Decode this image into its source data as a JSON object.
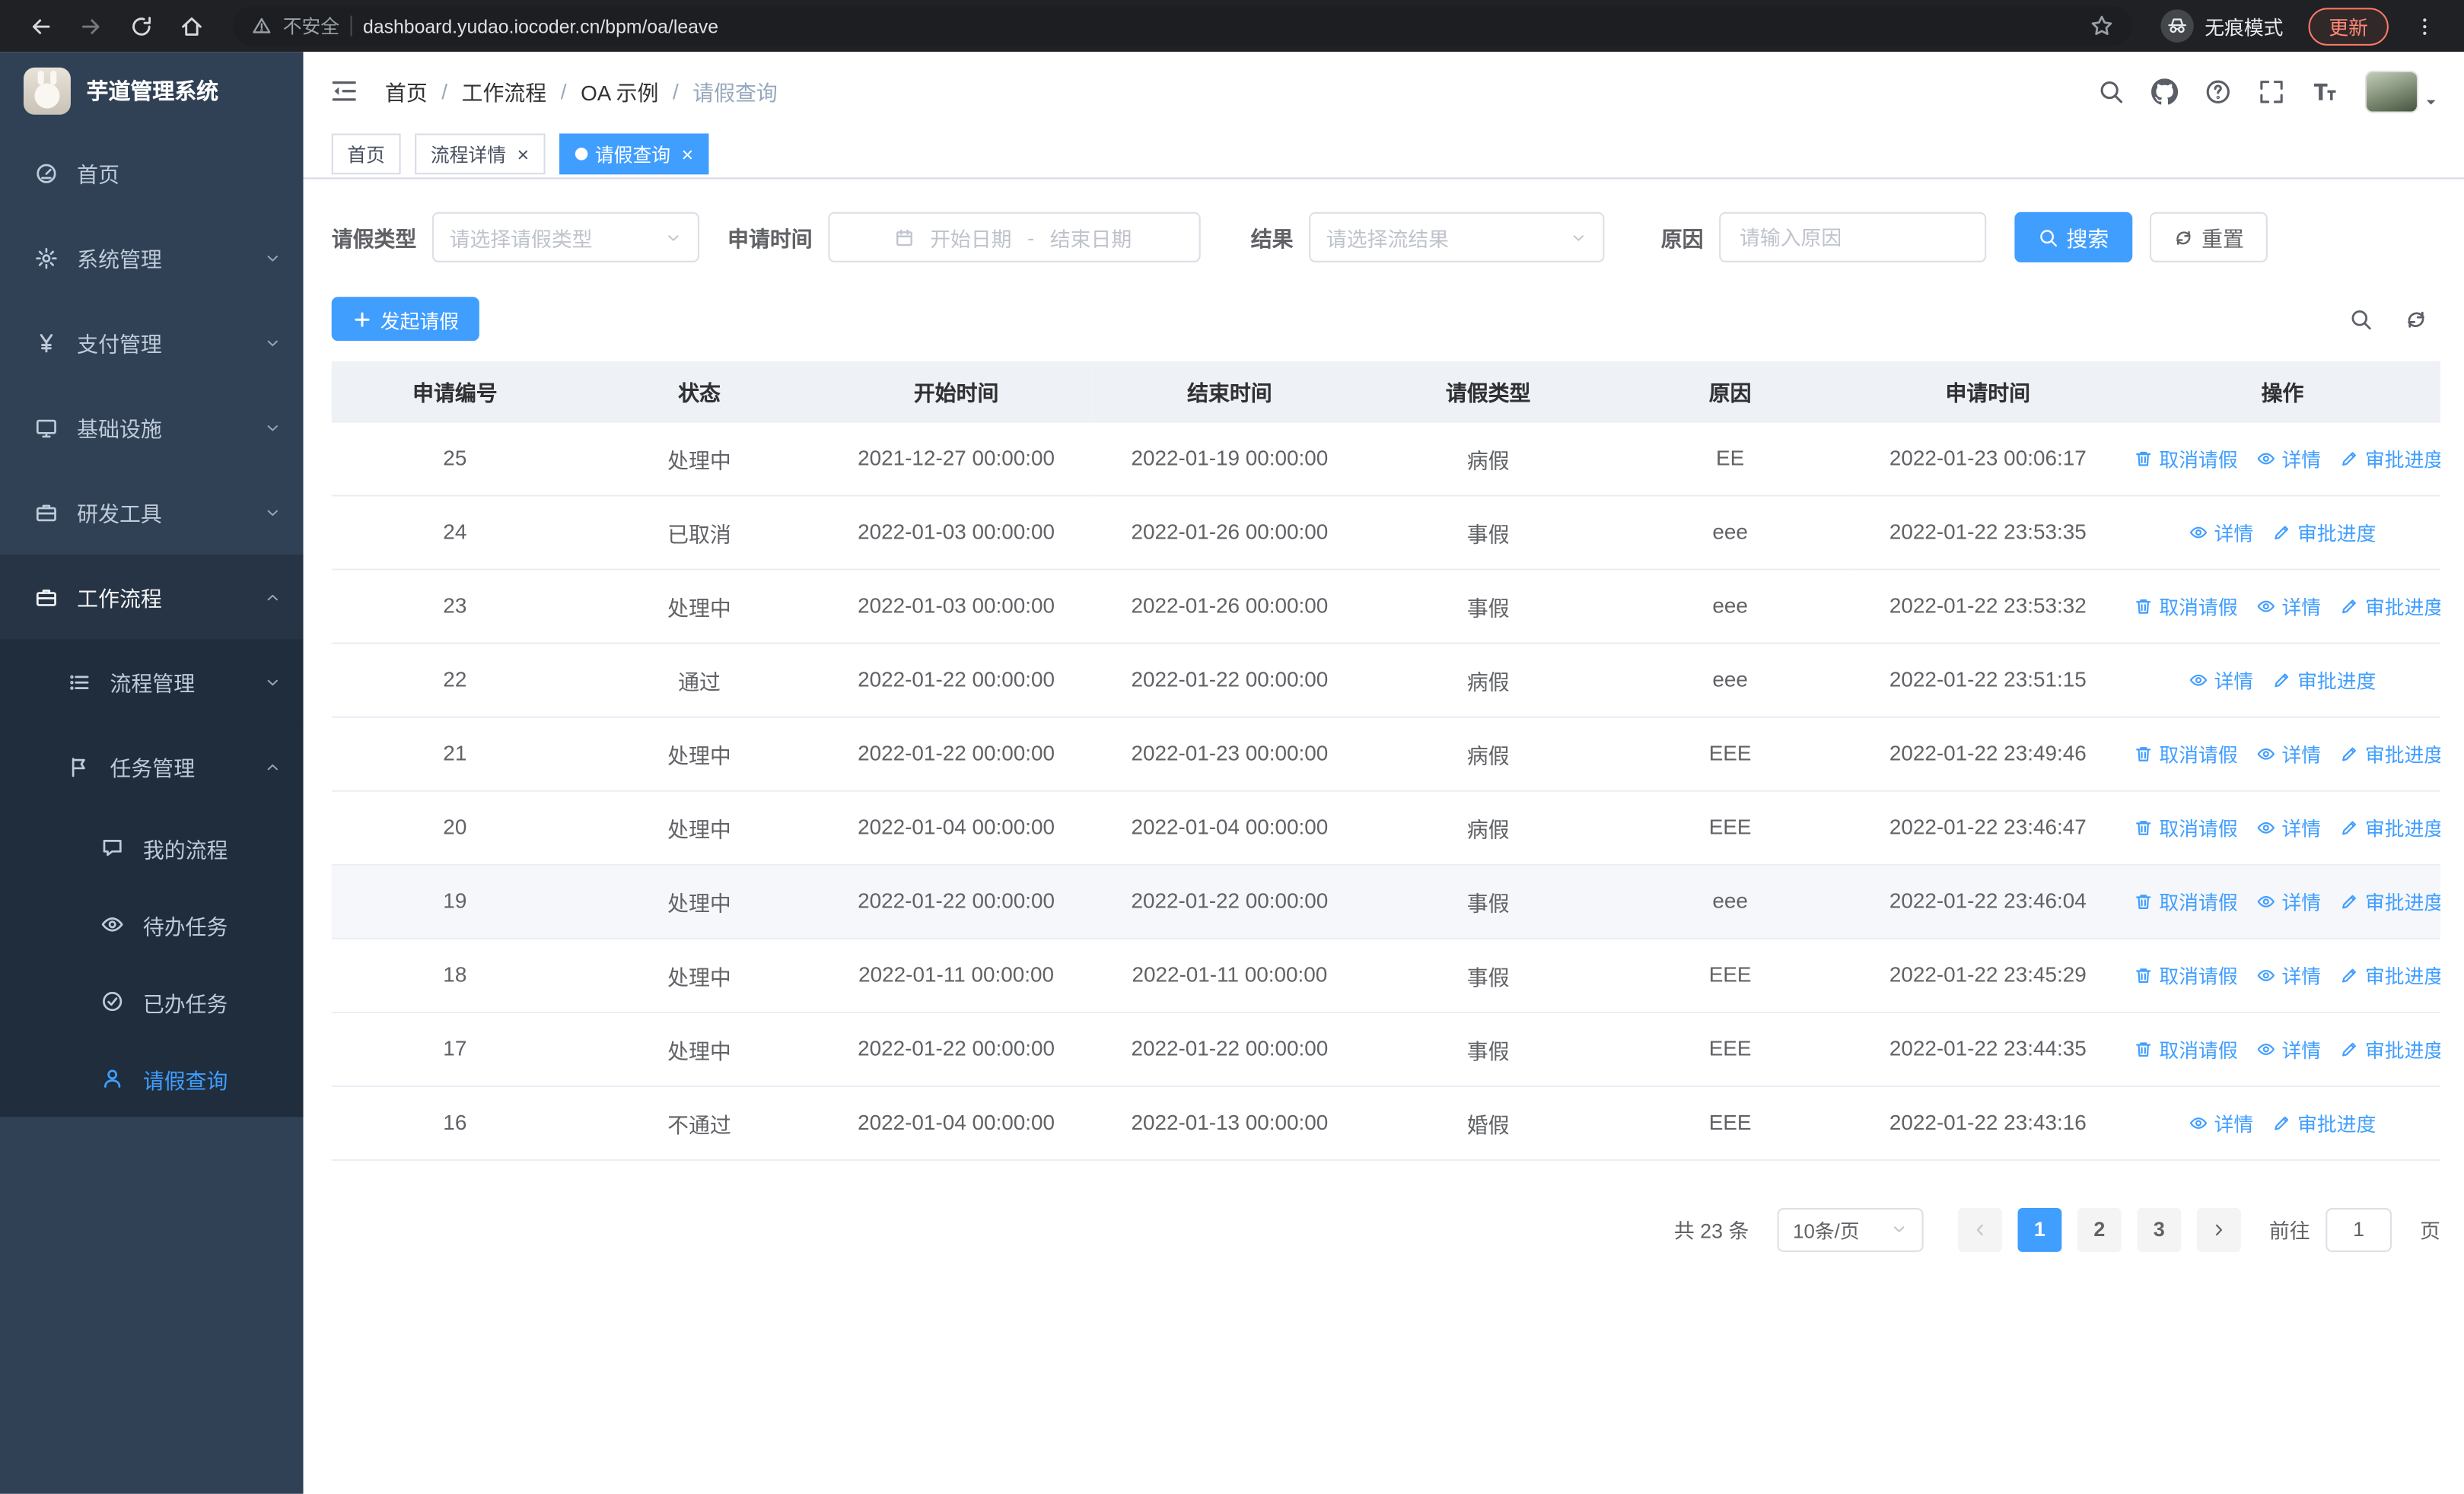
{
  "browser": {
    "security_label": "不安全",
    "url": "dashboard.yudao.iocoder.cn/bpm/oa/leave",
    "incognito_label": "无痕模式",
    "update_label": "更新"
  },
  "app": {
    "logo_title": "芋道管理系统"
  },
  "sidebar": {
    "items": [
      {
        "key": "home",
        "label": "首页",
        "icon": "dashboard",
        "level": 1
      },
      {
        "key": "system",
        "label": "系统管理",
        "icon": "gear",
        "level": 1,
        "chevron": "down"
      },
      {
        "key": "payment",
        "label": "支付管理",
        "icon": "yen",
        "level": 1,
        "chevron": "down"
      },
      {
        "key": "infrastructure",
        "label": "基础设施",
        "icon": "monitor",
        "level": 1,
        "chevron": "down"
      },
      {
        "key": "dev-tools",
        "label": "研发工具",
        "icon": "briefcase",
        "level": 1,
        "chevron": "down"
      },
      {
        "key": "workflow",
        "label": "工作流程",
        "icon": "briefcase",
        "level": 1,
        "chevron": "up",
        "open": true
      },
      {
        "key": "process-mgmt",
        "label": "流程管理",
        "icon": "list",
        "level": 2,
        "chevron": "down"
      },
      {
        "key": "task-mgmt",
        "label": "任务管理",
        "icon": "flag",
        "level": 2,
        "chevron": "up",
        "open": true
      },
      {
        "key": "my-process",
        "label": "我的流程",
        "icon": "chat",
        "level": 3
      },
      {
        "key": "todo-task",
        "label": "待办任务",
        "icon": "eye",
        "level": 3
      },
      {
        "key": "done-task",
        "label": "已办任务",
        "icon": "check-circle",
        "level": 3
      },
      {
        "key": "leave-query",
        "label": "请假查询",
        "icon": "user",
        "level": 3,
        "active": true
      }
    ]
  },
  "header": {
    "breadcrumb": [
      {
        "label": "首页"
      },
      {
        "label": "工作流程"
      },
      {
        "label": "OA 示例"
      },
      {
        "label": "请假查询",
        "current": true
      }
    ]
  },
  "tabs": [
    {
      "key": "home",
      "label": "首页"
    },
    {
      "key": "process-detail",
      "label": "流程详情",
      "closable": true
    },
    {
      "key": "leave-query",
      "label": "请假查询",
      "closable": true,
      "active": true
    }
  ],
  "filters": {
    "leave_type_label": "请假类型",
    "leave_type_placeholder": "请选择请假类型",
    "apply_time_label": "申请时间",
    "start_date_placeholder": "开始日期",
    "range_separator": "-",
    "end_date_placeholder": "结束日期",
    "result_label": "结果",
    "result_placeholder": "请选择流结果",
    "reason_label": "原因",
    "reason_placeholder": "请输入原因",
    "search_label": "搜索",
    "reset_label": "重置"
  },
  "toolbar": {
    "create_label": "发起请假"
  },
  "table": {
    "columns": [
      "申请编号",
      "状态",
      "开始时间",
      "结束时间",
      "请假类型",
      "原因",
      "申请时间",
      "操作"
    ],
    "action_labels": {
      "cancel": "取消请假",
      "detail": "详情",
      "progress": "审批进度"
    },
    "rows": [
      {
        "id": "25",
        "status": "处理中",
        "start": "2021-12-27 00:00:00",
        "end": "2022-01-19 00:00:00",
        "type": "病假",
        "reason": "EE",
        "apply_time": "2022-01-23 00:06:17",
        "actions": [
          "cancel",
          "detail",
          "progress"
        ]
      },
      {
        "id": "24",
        "status": "已取消",
        "start": "2022-01-03 00:00:00",
        "end": "2022-01-26 00:00:00",
        "type": "事假",
        "reason": "eee",
        "apply_time": "2022-01-22 23:53:35",
        "actions": [
          "detail",
          "progress"
        ]
      },
      {
        "id": "23",
        "status": "处理中",
        "start": "2022-01-03 00:00:00",
        "end": "2022-01-26 00:00:00",
        "type": "事假",
        "reason": "eee",
        "apply_time": "2022-01-22 23:53:32",
        "actions": [
          "cancel",
          "detail",
          "progress"
        ]
      },
      {
        "id": "22",
        "status": "通过",
        "start": "2022-01-22 00:00:00",
        "end": "2022-01-22 00:00:00",
        "type": "病假",
        "reason": "eee",
        "apply_time": "2022-01-22 23:51:15",
        "actions": [
          "detail",
          "progress"
        ]
      },
      {
        "id": "21",
        "status": "处理中",
        "start": "2022-01-22 00:00:00",
        "end": "2022-01-23 00:00:00",
        "type": "病假",
        "reason": "EEE",
        "apply_time": "2022-01-22 23:49:46",
        "actions": [
          "cancel",
          "detail",
          "progress"
        ]
      },
      {
        "id": "20",
        "status": "处理中",
        "start": "2022-01-04 00:00:00",
        "end": "2022-01-04 00:00:00",
        "type": "病假",
        "reason": "EEE",
        "apply_time": "2022-01-22 23:46:47",
        "actions": [
          "cancel",
          "detail",
          "progress"
        ]
      },
      {
        "id": "19",
        "status": "处理中",
        "start": "2022-01-22 00:00:00",
        "end": "2022-01-22 00:00:00",
        "type": "事假",
        "reason": "eee",
        "apply_time": "2022-01-22 23:46:04",
        "actions": [
          "cancel",
          "detail",
          "progress"
        ],
        "highlight": true
      },
      {
        "id": "18",
        "status": "处理中",
        "start": "2022-01-11 00:00:00",
        "end": "2022-01-11 00:00:00",
        "type": "事假",
        "reason": "EEE",
        "apply_time": "2022-01-22 23:45:29",
        "actions": [
          "cancel",
          "detail",
          "progress"
        ]
      },
      {
        "id": "17",
        "status": "处理中",
        "start": "2022-01-22 00:00:00",
        "end": "2022-01-22 00:00:00",
        "type": "事假",
        "reason": "EEE",
        "apply_time": "2022-01-22 23:44:35",
        "actions": [
          "cancel",
          "detail",
          "progress"
        ]
      },
      {
        "id": "16",
        "status": "不通过",
        "start": "2022-01-04 00:00:00",
        "end": "2022-01-13 00:00:00",
        "type": "婚假",
        "reason": "EEE",
        "apply_time": "2022-01-22 23:43:16",
        "actions": [
          "detail",
          "progress"
        ]
      }
    ]
  },
  "pagination": {
    "total_label": "共 23 条",
    "page_size_label": "10条/页",
    "pages": [
      "1",
      "2",
      "3"
    ],
    "active_page": "1",
    "goto_label": "前往",
    "goto_value": "1",
    "page_unit_label": "页"
  },
  "colors": {
    "primary": "#409eff",
    "sidebar_bg": "#304156",
    "submenu_bg": "#1f2d3d"
  }
}
